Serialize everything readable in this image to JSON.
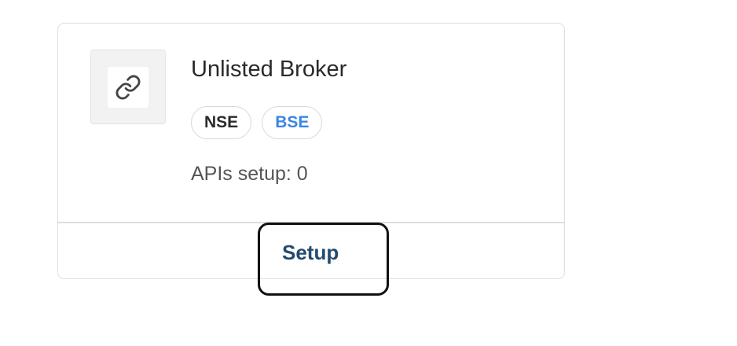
{
  "card": {
    "broker_name": "Unlisted Broker",
    "logo_icon": "link-icon",
    "exchanges": [
      {
        "label": "NSE",
        "color": "#2a2a2a"
      },
      {
        "label": "BSE",
        "color": "#3a86e6"
      }
    ],
    "apis_text": "APIs setup: 0",
    "setup_label": "Setup",
    "accent_color": "#234b6e"
  }
}
